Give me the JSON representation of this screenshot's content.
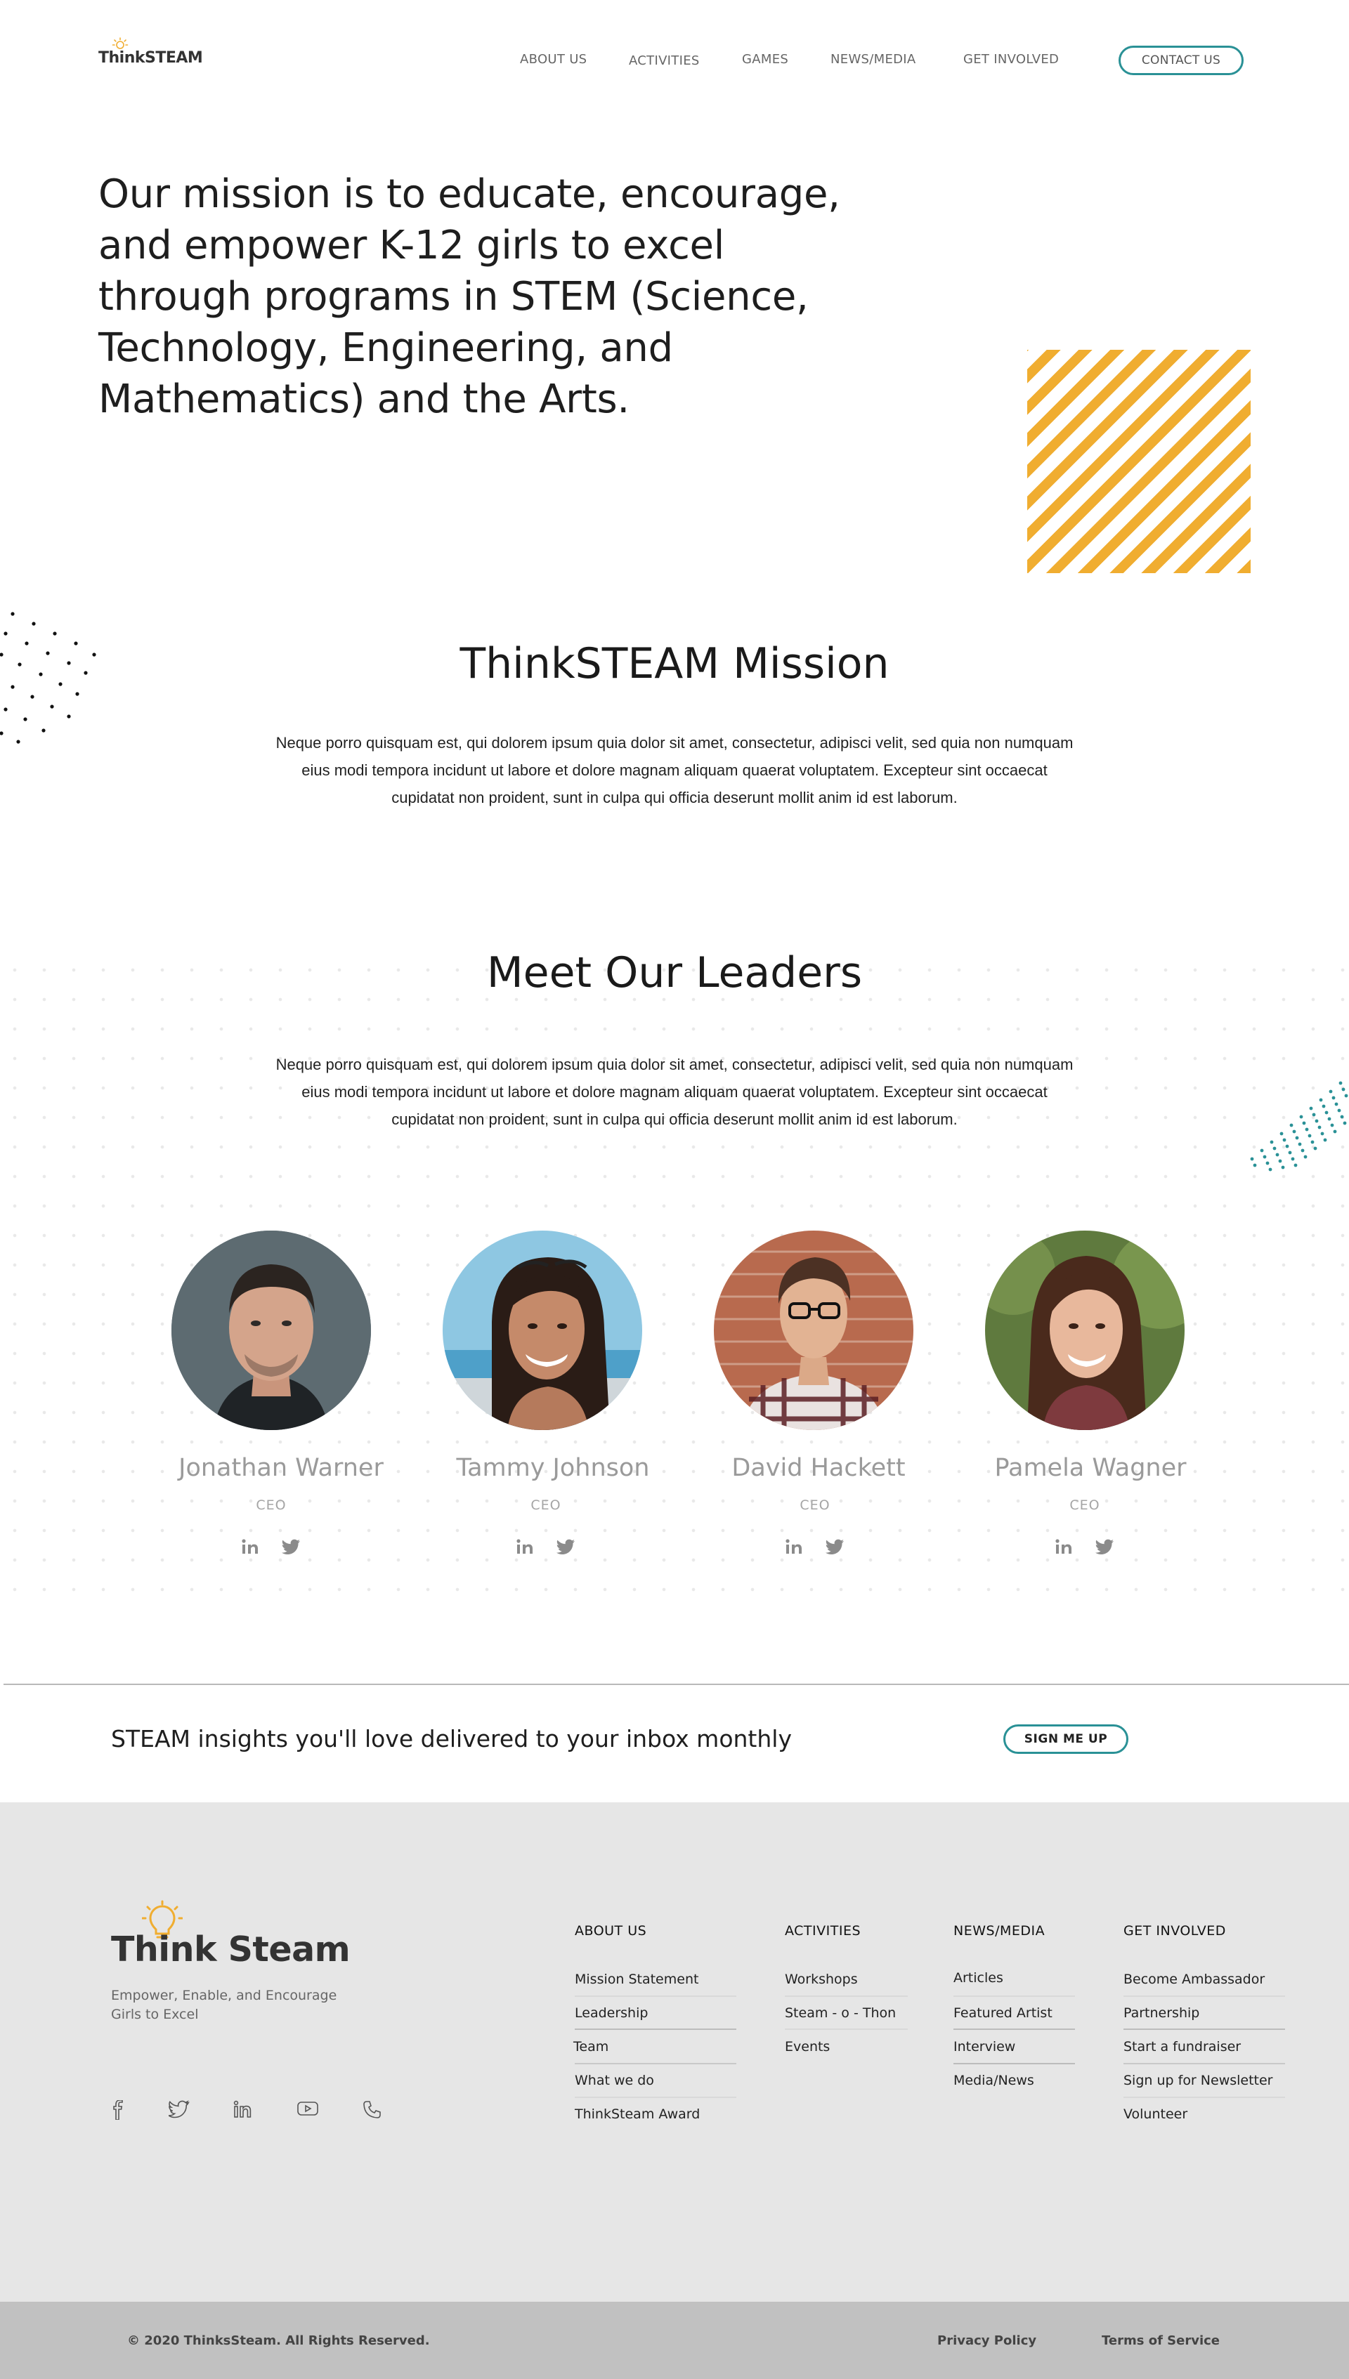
{
  "header": {
    "logo_text": "ThinkSTEAM",
    "nav": [
      "ABOUT US",
      "ACTIVITIES",
      "GAMES",
      "NEWS/MEDIA",
      "GET INVOLVED"
    ],
    "contact_label": "CONTACT US"
  },
  "hero": {
    "title": "Our mission is to educate, encourage, and empower K-12 girls to excel through programs in STEM (Science, Technology, Engineering, and Mathematics) and the Arts."
  },
  "mission": {
    "title": "ThinkSTEAM Mission",
    "body": "Neque porro quisquam est, qui dolorem ipsum quia  dolor sit amet, consectetur, adipisci velit, sed quia non numquam eius modi tempora incidunt ut labore et  dolore magnam aliquam quaerat voluptatem. Excepteur sint occaecat cupidatat non proident, sunt in culpa qui  officia deserunt mollit anim id est laborum."
  },
  "leaders": {
    "title": "Meet Our Leaders",
    "body": "Neque porro quisquam est, qui dolorem ipsum quia  dolor sit amet, consectetur, adipisci velit, sed quia non numquam eius modi tempora incidunt ut labore et  dolore magnam aliquam quaerat voluptatem. Excepteur sint occaecat cupidatat non proident, sunt in culpa qui  officia deserunt mollit anim id est laborum.",
    "people": [
      {
        "name": "Jonathan Warner",
        "role": "CEO"
      },
      {
        "name": "Tammy Johnson",
        "role": "CEO"
      },
      {
        "name": "David Hackett",
        "role": "CEO"
      },
      {
        "name": "Pamela Wagner",
        "role": "CEO"
      }
    ],
    "social_icons": [
      "linkedin-icon",
      "twitter-icon"
    ]
  },
  "newsletter": {
    "text": "STEAM insights you'll love delivered to your inbox monthly",
    "button_label": "SIGN ME UP"
  },
  "footer": {
    "logo_text": "Think Steam",
    "tagline": "Empower, Enable, and Encourage Girls to Excel",
    "social_icons": [
      "facebook-icon",
      "twitter-icon",
      "linkedin-icon",
      "youtube-icon",
      "phone-icon"
    ],
    "columns": [
      {
        "heading": "ABOUT US",
        "items": [
          "Mission Statement",
          "Leadership",
          "Team",
          "What we do",
          "ThinkSteam Award"
        ]
      },
      {
        "heading": "ACTIVITIES",
        "items": [
          "Workshops",
          "Steam - o - Thon",
          "Events"
        ]
      },
      {
        "heading": "NEWS/MEDIA",
        "items": [
          "Articles",
          "Featured Artist",
          "Interview",
          "Media/News"
        ]
      },
      {
        "heading": "GET INVOLVED",
        "items": [
          "Become Ambassador",
          "Partnership",
          "Start a fundraiser",
          "Sign up for Newsletter",
          "Volunteer"
        ]
      }
    ],
    "copyright": "© 2020 ThinksSteam.  All Rights Reserved.",
    "privacy_label": "Privacy Policy",
    "terms_label": "Terms of Service"
  },
  "colors": {
    "accent_teal": "#2a9196",
    "accent_orange": "#f0ad30",
    "footer_bg": "#e6e6e6",
    "bottom_bar_bg": "#c1c1c1"
  }
}
